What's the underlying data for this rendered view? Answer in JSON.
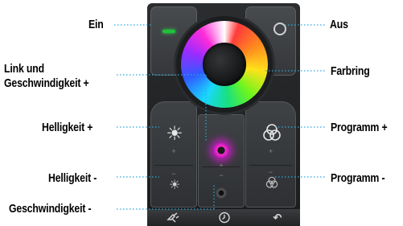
{
  "labels": {
    "ein": "Ein",
    "aus": "Aus",
    "link_line1": "Link und",
    "link_line2": "Geschwindigkeit +",
    "farbring": "Farbring",
    "helligkeit_plus": "Helligkeit +",
    "programm_plus": "Programm +",
    "helligkeit_minus": "Helligkeit -",
    "programm_minus": "Programm -",
    "geschwindigkeit_minus": "Geschwindigkeit -"
  },
  "colors": {
    "leader_line": "#29a8e0",
    "on_indicator": "#1fc43a",
    "link_glow": "#c11fbf",
    "panel_background": "#2b2d2f"
  },
  "icons": {
    "ein": "power-on-indicator-icon",
    "aus": "power-off-circle-icon",
    "helligkeit_plus": "sun-large-icon",
    "helligkeit_minus": "sun-small-icon",
    "programm_plus": "overlapping-circles-icon",
    "programm_minus": "overlapping-circles-small-icon",
    "link": "glowing-dot-icon",
    "geschwindigkeit_minus": "dim-dot-icon",
    "bottom_left": "plug-icon",
    "bottom_mid": "clock-icon",
    "bottom_right": "back-arrow-icon"
  },
  "glyphs": {
    "plus": "+",
    "minus": "−",
    "sun": "☀",
    "back": "↶"
  }
}
